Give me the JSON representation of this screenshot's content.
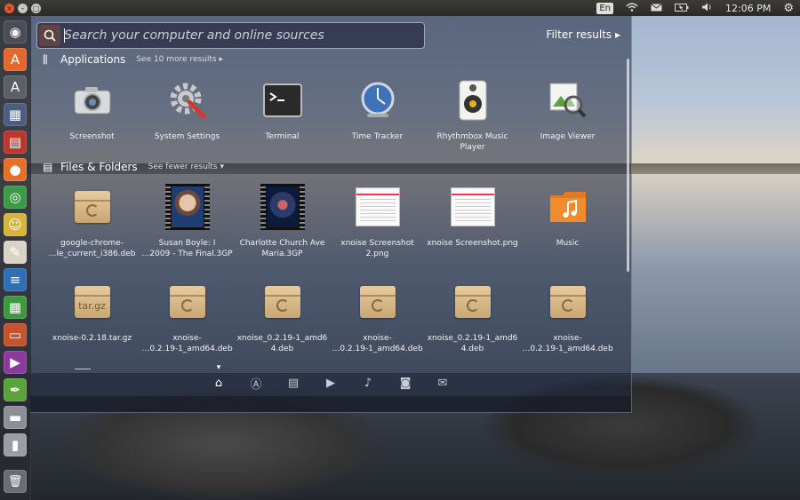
{
  "top_panel": {
    "keyboard_layout": "En",
    "clock": "12:06 PM"
  },
  "launcher": {
    "items": [
      {
        "name": "ubuntu-dash",
        "glyph": "◉",
        "bg": "#4a4d55"
      },
      {
        "name": "software-center",
        "glyph": "A",
        "bg": "#e4672b"
      },
      {
        "name": "update-manager",
        "glyph": "A",
        "bg": "#5c5f66"
      },
      {
        "name": "workspace-switcher",
        "glyph": "▦",
        "bg": "#4b5d80"
      },
      {
        "name": "calendar",
        "glyph": "▤",
        "bg": "#b9382b"
      },
      {
        "name": "firefox",
        "glyph": "●",
        "bg": "#e6702a"
      },
      {
        "name": "chrome",
        "glyph": "◎",
        "bg": "#3a9c49"
      },
      {
        "name": "pidgin",
        "glyph": "☺",
        "bg": "#d8b43a"
      },
      {
        "name": "text-editor",
        "glyph": "✎",
        "bg": "#d9d4c6"
      },
      {
        "name": "writer",
        "glyph": "≡",
        "bg": "#2f6fb5"
      },
      {
        "name": "calc",
        "glyph": "▦",
        "bg": "#3b9a3e"
      },
      {
        "name": "impress",
        "glyph": "▭",
        "bg": "#c5532e"
      },
      {
        "name": "video-player",
        "glyph": "▶",
        "bg": "#8a3b9a"
      },
      {
        "name": "inkscape",
        "glyph": "✒",
        "bg": "#5aa33a"
      },
      {
        "name": "drive",
        "glyph": "▬",
        "bg": "#8c8f96"
      },
      {
        "name": "usb-drive",
        "glyph": "▮",
        "bg": "#9a9da3"
      }
    ],
    "trash_glyph": "🗑"
  },
  "search": {
    "placeholder": "Search your computer and online sources",
    "value": ""
  },
  "filter_label": "Filter results ▸",
  "applications": {
    "title": "Applications",
    "link": "See 10 more results ▸",
    "items": [
      {
        "label": "Screenshot",
        "icon": "camera-icon"
      },
      {
        "label": "System Settings",
        "icon": "gear-icon"
      },
      {
        "label": "Terminal",
        "icon": "terminal-icon"
      },
      {
        "label": "Time Tracker",
        "icon": "clock-icon"
      },
      {
        "label": "Rhythmbox Music\nPlayer",
        "icon": "speaker-icon"
      },
      {
        "label": "Image Viewer",
        "icon": "image-viewer-icon"
      }
    ]
  },
  "files": {
    "title": "Files & Folders",
    "link": "See fewer results ▾",
    "row1": [
      {
        "label": "google-chrome-\n…le_current_i386.deb",
        "icon": "deb-package-icon"
      },
      {
        "label": "Susan Boyle: I\n…2009 - The Final.3GP",
        "icon": "video-thumbnail"
      },
      {
        "label": "Charlotte Church Ave\nMaria.3GP",
        "icon": "video-thumbnail"
      },
      {
        "label": "xnoise Screenshot\n2.png",
        "icon": "screenshot-thumbnail"
      },
      {
        "label": "xnoise Screenshot.png",
        "icon": "screenshot-thumbnail"
      },
      {
        "label": "Music",
        "icon": "music-folder-icon"
      }
    ],
    "row2": [
      {
        "label": "xnoise-0.2.18.tar.gz",
        "icon": "tar-package-icon",
        "pkg_text": "tar.gz"
      },
      {
        "label": "xnoise-\n…0.2.19-1_amd64.deb",
        "icon": "deb-package-icon"
      },
      {
        "label": "xnoise_0.2.19-1_amd6\n4.deb",
        "icon": "deb-package-icon"
      },
      {
        "label": "xnoise-\n…0.2.19-1_amd64.deb",
        "icon": "deb-package-icon"
      },
      {
        "label": "xnoise_0.2.19-1_amd6\n4.deb",
        "icon": "deb-package-icon"
      },
      {
        "label": "xnoise-\n…0.2.19-1_amd64.deb",
        "icon": "deb-package-icon"
      }
    ]
  },
  "lenses": [
    {
      "name": "home-lens",
      "glyph": "⌂",
      "active": true
    },
    {
      "name": "applications-lens",
      "glyph": "Ⓐ",
      "active": false
    },
    {
      "name": "files-lens",
      "glyph": "▤",
      "active": false
    },
    {
      "name": "video-lens",
      "glyph": "▶",
      "active": false
    },
    {
      "name": "music-lens",
      "glyph": "♪",
      "active": false
    },
    {
      "name": "photo-lens",
      "glyph": "◙",
      "active": false
    },
    {
      "name": "social-lens",
      "glyph": "✉",
      "active": false
    }
  ]
}
